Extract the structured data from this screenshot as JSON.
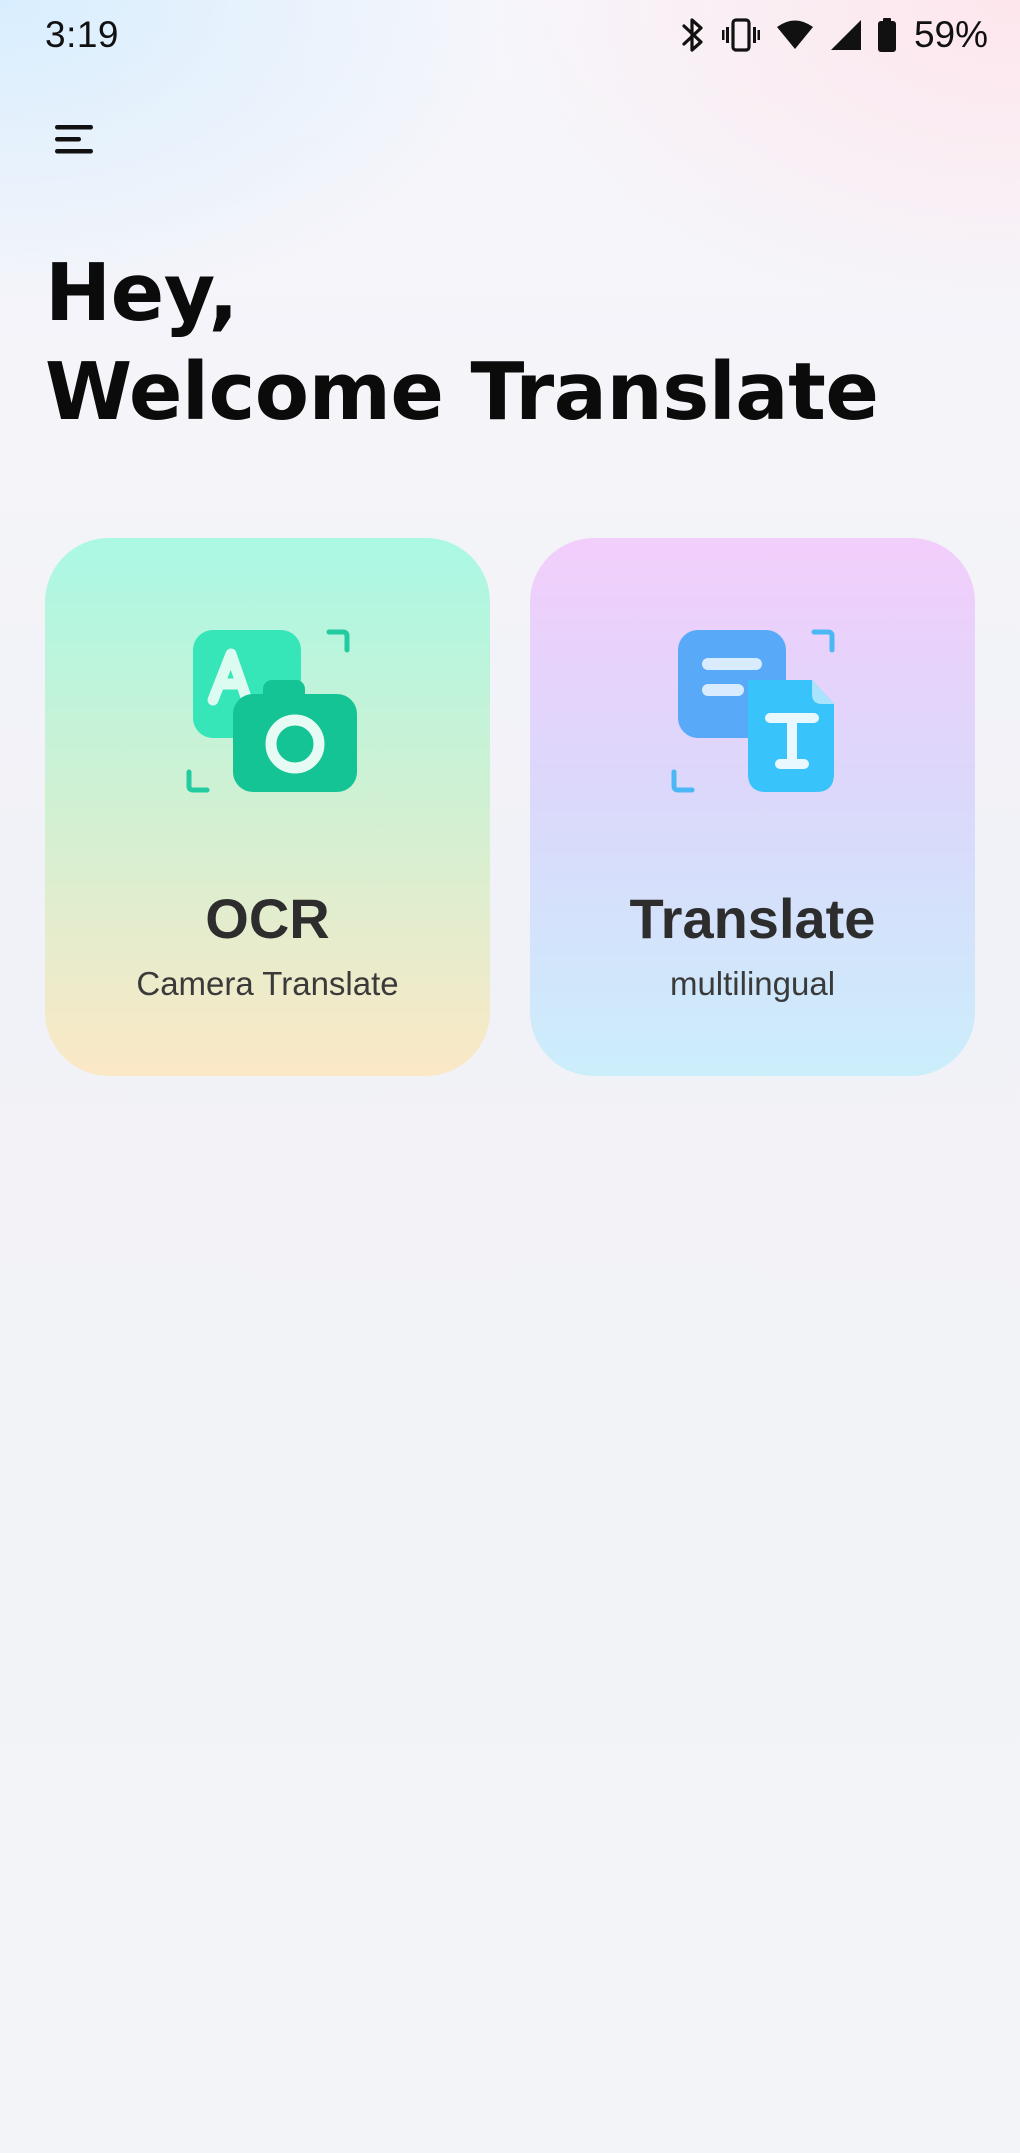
{
  "status_bar": {
    "time": "3:19",
    "battery": "59%",
    "icons": [
      "bluetooth-icon",
      "vibrate-icon",
      "wifi-icon",
      "signal-icon",
      "battery-icon"
    ]
  },
  "header": {
    "menu_icon": "hamburger-menu-icon"
  },
  "greeting": {
    "line1": "Hey,",
    "line2": "Welcome Translate"
  },
  "cards": [
    {
      "title": "OCR",
      "subtitle": "Camera Translate",
      "icon": "camera-letter-icon",
      "accent": "#1ec9a0"
    },
    {
      "title": "Translate",
      "subtitle": "multilingual",
      "icon": "document-text-icon",
      "accent": "#3fb4ff"
    }
  ],
  "colors": {
    "ocr_card_top": "#aaf8e4",
    "ocr_card_bottom": "#fbe8c6",
    "translate_card_top": "#f2cefb",
    "translate_card_bottom": "#cbeefb"
  }
}
